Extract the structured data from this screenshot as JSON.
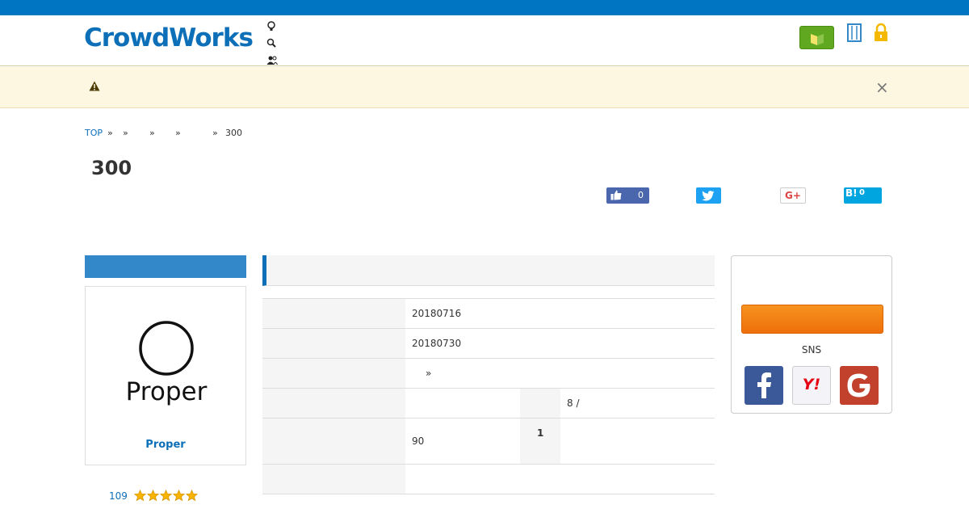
{
  "topbar": {
    "text": ""
  },
  "header": {
    "logo": "CrowdWorks",
    "nav": [
      {
        "icon": "lightbulb-icon",
        "label": ""
      },
      {
        "icon": "search-icon",
        "label": ""
      },
      {
        "icon": "users-icon",
        "label": ""
      }
    ],
    "green_button_label": "",
    "links_text": ""
  },
  "alert": {
    "close": "×"
  },
  "breadcrumb": {
    "top": "TOP",
    "sep": "»",
    "last": "300"
  },
  "page": {
    "title": "300"
  },
  "social": {
    "fb_count": "0",
    "hatena_label": "B!",
    "hatena_count": "0",
    "gplus_label": "G+"
  },
  "client": {
    "logo_text": "Proper",
    "name": "Proper",
    "rating_count": "109",
    "stars": 5
  },
  "details": {
    "row1_value": "20180716",
    "row2_value": "20180730",
    "row3_value": "»",
    "row4_value": "8 /",
    "row5_value": "90",
    "row5_label2": "1"
  },
  "apply": {
    "sns_label": "SNS",
    "yahoo_label": "Y!"
  },
  "colors": {
    "brand": "#0d6fb8",
    "topbar": "#0075c2",
    "apply": "#f38418",
    "alert_bg": "#fdf7e2"
  }
}
